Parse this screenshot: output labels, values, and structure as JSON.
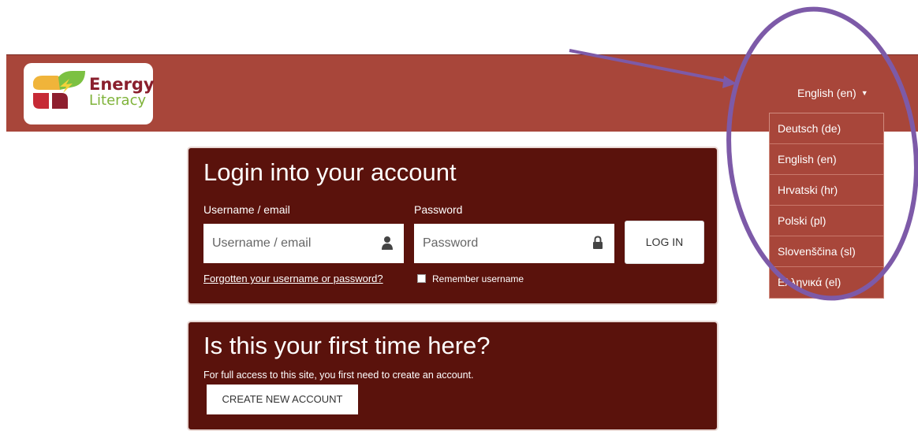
{
  "header": {
    "logo": {
      "line1": "Energy",
      "line2": "Literacy"
    },
    "language": {
      "current": "English (en)",
      "options": [
        "Deutsch (de)",
        "English (en)",
        "Hrvatski (hr)",
        "Polski (pl)",
        "Slovenščina (sl)",
        "Ελληνικά (el)"
      ]
    }
  },
  "login": {
    "title": "Login into your account",
    "username_label": "Username / email",
    "username_placeholder": "Username / email",
    "password_label": "Password",
    "password_placeholder": "Password",
    "login_button": "LOG IN",
    "forgot_link": "Forgotten your username or password?",
    "remember_label": "Remember username"
  },
  "signup": {
    "title": "Is this your first time here?",
    "info": "For full access to this site, you first need to create an account.",
    "create_button": "CREATE NEW ACCOUNT"
  },
  "colors": {
    "header_bg": "#a8463a",
    "card_bg": "#5a120c",
    "annotation": "#7d5aa8"
  },
  "icons": [
    "user-icon",
    "lock-icon",
    "caret-down-icon",
    "logo-icon"
  ]
}
